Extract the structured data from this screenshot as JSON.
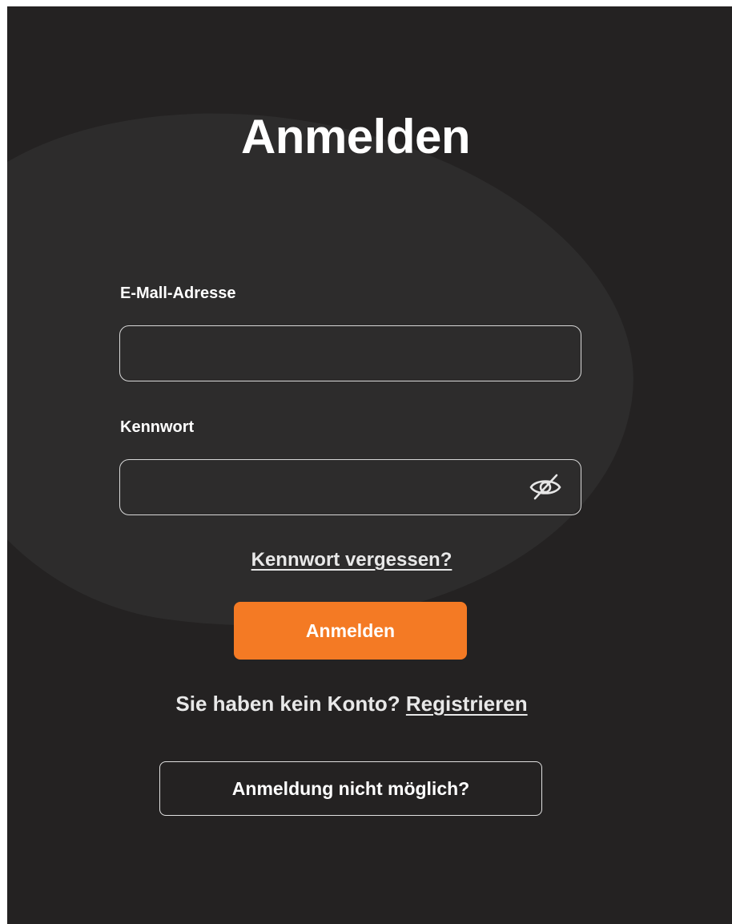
{
  "login": {
    "title": "Anmelden",
    "email_label": "E-Mall-Adresse",
    "email_value": "",
    "password_label": "Kennwort",
    "password_value": "",
    "password_toggle_icon": "eye-slash-icon",
    "forgot_password": "Kennwort vergessen?",
    "submit_label": "Anmelden",
    "no_account_text": "Sie haben kein Konto?",
    "register_link": "Registrieren",
    "trouble_label": "Anmeldung nicht möglich?"
  },
  "colors": {
    "background": "#242222",
    "accent": "#f47a24",
    "text": "#ffffff",
    "border": "#d8d8d8"
  }
}
